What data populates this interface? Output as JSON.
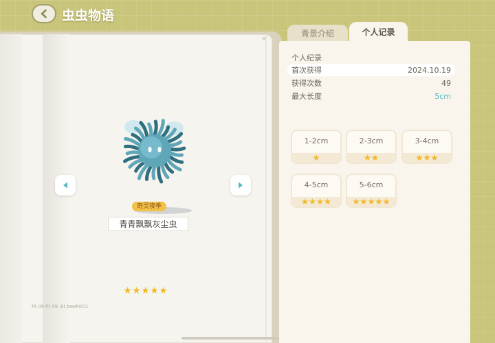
{
  "header": {
    "title": "虫虫物语"
  },
  "tabs": [
    {
      "label": "青景介绍",
      "active": false
    },
    {
      "label": "个人记录",
      "active": true
    }
  ],
  "creature": {
    "badge": "奇灵夜季",
    "name": "青青飘飘灰尘虫",
    "rarity_stars": 5,
    "colors": {
      "body": "#5fa7b8",
      "body_dark": "#2f6f80",
      "wing": "#cfe9ee"
    }
  },
  "footer": {
    "left_a": "Pt 09",
    "left_b": "Pt 09",
    "left_c": "Et beehK01"
  },
  "record": {
    "section_title": "个人纪录",
    "rows": [
      {
        "label": "首次获得",
        "value": "2024.10.19",
        "highlight": true
      },
      {
        "label": "获得次数",
        "value": "49",
        "highlight": false
      },
      {
        "label": "最大长度",
        "value": "5cm",
        "highlight": false,
        "accent": true
      }
    ]
  },
  "sizes": [
    {
      "label": "1-2cm",
      "stars": 1
    },
    {
      "label": "2-3cm",
      "stars": 2
    },
    {
      "label": "3-4cm",
      "stars": 3
    },
    {
      "label": "4-5cm",
      "stars": 4
    },
    {
      "label": "5-6cm",
      "stars": 5
    }
  ],
  "icons": {
    "back": "back-arrow-icon",
    "prev": "triangle-left-icon",
    "next": "triangle-right-icon",
    "star": "star-icon"
  },
  "colors": {
    "background": "#c9c57a",
    "panel": "#f9f5ec",
    "accent_teal": "#54b7c2",
    "star": "#f2b927",
    "badge": "#f2c14a"
  }
}
